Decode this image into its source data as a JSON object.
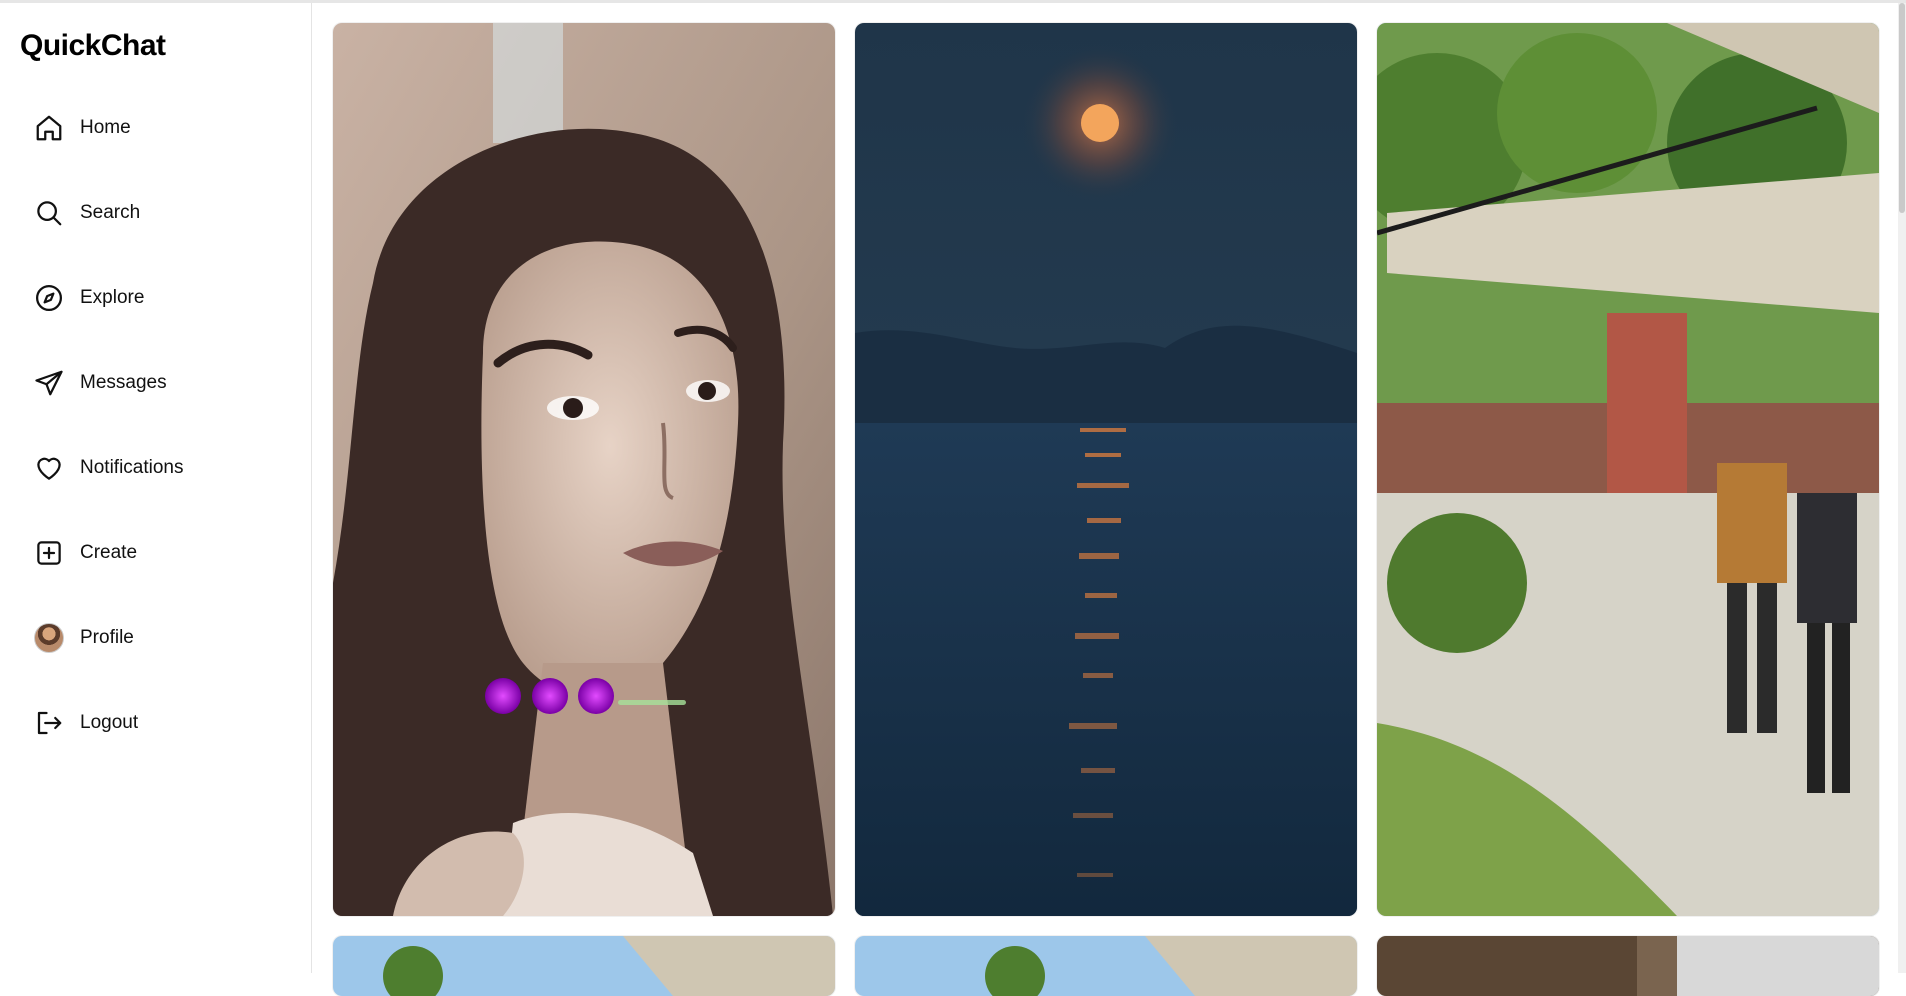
{
  "app": {
    "title": "QuickChat"
  },
  "sidebar": {
    "items": [
      {
        "label": "Home",
        "icon": "home-icon"
      },
      {
        "label": "Search",
        "icon": "search-icon"
      },
      {
        "label": "Explore",
        "icon": "compass-icon"
      },
      {
        "label": "Messages",
        "icon": "send-icon"
      },
      {
        "label": "Notifications",
        "icon": "heart-icon"
      },
      {
        "label": "Create",
        "icon": "plus-square-icon"
      },
      {
        "label": "Profile",
        "icon": "avatar"
      },
      {
        "label": "Logout",
        "icon": "logout-icon"
      }
    ]
  },
  "feed": {
    "posts": [
      {
        "subject": "portrait of woman with purple devil emojis"
      },
      {
        "subject": "full moon over lake at night"
      },
      {
        "subject": "people under building porch with trees"
      },
      {
        "subject": "porch roof and trees"
      },
      {
        "subject": "porch roof and trees"
      },
      {
        "subject": "building interior"
      }
    ]
  },
  "colors": {
    "accent": "#000000",
    "border": "#e4e4e4"
  }
}
